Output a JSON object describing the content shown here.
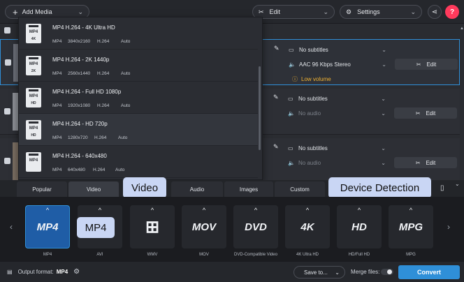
{
  "toolbar": {
    "add_media": "Add Media",
    "edit": "Edit",
    "settings": "Settings",
    "share_icon": "share-icon",
    "help": "?"
  },
  "files": [
    {
      "subtitles": "No subtitles",
      "audio": "AAC 96 Kbps Stereo",
      "edit": "Edit",
      "warning": "Low volume"
    },
    {
      "subtitles": "No subtitles",
      "audio": "No audio",
      "edit": "Edit"
    },
    {
      "subtitles": "No subtitles",
      "audio": "No audio",
      "edit": "Edit"
    }
  ],
  "formats": [
    {
      "name": "MP4 H.264 - 4K Ultra HD",
      "container": "MP4",
      "res": "3840x2160",
      "codec": "H.264",
      "fps": "Auto",
      "tag": "4K"
    },
    {
      "name": "MP4 H.264 - 2K 1440p",
      "container": "MP4",
      "res": "2560x1440",
      "codec": "H.264",
      "fps": "Auto",
      "tag": "2K"
    },
    {
      "name": "MP4 H.264 - Full HD 1080p",
      "container": "MP4",
      "res": "1920x1080",
      "codec": "H.264",
      "fps": "Auto",
      "tag": "HD"
    },
    {
      "name": "MP4 H.264 - HD 720p",
      "container": "MP4",
      "res": "1280x720",
      "codec": "H.264",
      "fps": "Auto",
      "tag": "HD"
    },
    {
      "name": "MP4 H.264 - 640x480",
      "container": "MP4",
      "res": "640x480",
      "codec": "H.264",
      "fps": "Auto",
      "tag": ""
    }
  ],
  "tabs": {
    "popular": "Popular",
    "video": "Video",
    "audio": "Audio",
    "images": "Images",
    "custom": "Custom"
  },
  "callouts": {
    "video": "Video",
    "device": "Device Detection",
    "mp4": "MP4"
  },
  "presets": [
    {
      "icon": "MP4",
      "label": "MP4"
    },
    {
      "icon": "",
      "label": "AVI"
    },
    {
      "icon": "",
      "label": "WMV"
    },
    {
      "icon": "MOV",
      "label": "MOV"
    },
    {
      "icon": "DVD",
      "label": "DVD-Compatible Video"
    },
    {
      "icon": "4K",
      "label": "4K Ultra HD"
    },
    {
      "icon": "HD",
      "label": "HD/Full HD"
    },
    {
      "icon": "MPG",
      "label": "MPG"
    }
  ],
  "bottom": {
    "output_label": "Output format:",
    "output_value": "MP4",
    "save_to": "Save to...",
    "merge": "Merge files:",
    "convert": "Convert"
  },
  "colors": {
    "accent": "#2f8fd8",
    "warning": "#f0b232",
    "help": "#ff3a5c",
    "callout": "#c9d6f4"
  }
}
